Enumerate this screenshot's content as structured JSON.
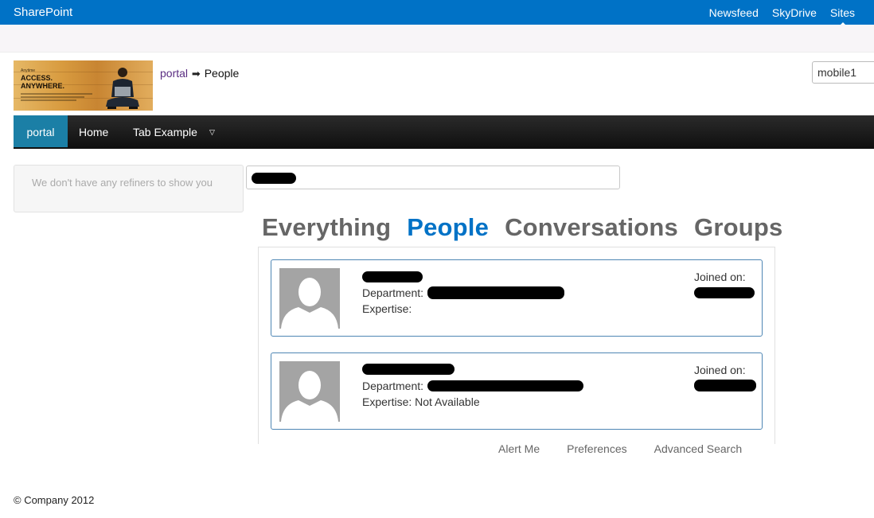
{
  "suite_bar": {
    "brand": "SharePoint",
    "links": [
      {
        "label": "Newsfeed",
        "active": false
      },
      {
        "label": "SkyDrive",
        "active": false
      },
      {
        "label": "Sites",
        "active": true
      }
    ],
    "color": "#0072c6"
  },
  "header": {
    "logo": {
      "small_text": "Anytime",
      "headline_1": "ACCESS.",
      "headline_2": "ANYWHERE."
    },
    "breadcrumb": {
      "link": "portal",
      "arrow": "➡",
      "current": "People"
    },
    "search": {
      "value": "mobile1"
    }
  },
  "nav": {
    "items": [
      {
        "label": "portal",
        "active": true
      },
      {
        "label": "Home",
        "active": false
      },
      {
        "label": "Tab Example",
        "active": false
      }
    ],
    "dropdown_glyph": "▽",
    "active_color": "#1b7fa6"
  },
  "refiners": {
    "message": "We don't have any refiners to show you"
  },
  "verticals": {
    "tabs": [
      {
        "label": "Everything",
        "active": false
      },
      {
        "label": "People",
        "active": true
      },
      {
        "label": "Conversations",
        "active": false
      },
      {
        "label": "Groups",
        "active": false
      }
    ],
    "active_color": "#0072c6"
  },
  "results": [
    {
      "department_label": "Department:",
      "expertise_label": "Expertise:",
      "expertise_value": "",
      "joined_label": "Joined on:"
    },
    {
      "department_label": "Department:",
      "expertise_label": "Expertise:",
      "expertise_value": "Not Available",
      "joined_label": "Joined on:"
    }
  ],
  "footer": {
    "links": [
      "Alert Me",
      "Preferences",
      "Advanced Search"
    ],
    "copyright": "© Company 2012"
  },
  "icons": {
    "avatar": "person-silhouette-icon",
    "dropdown": "triangle-down-icon"
  }
}
